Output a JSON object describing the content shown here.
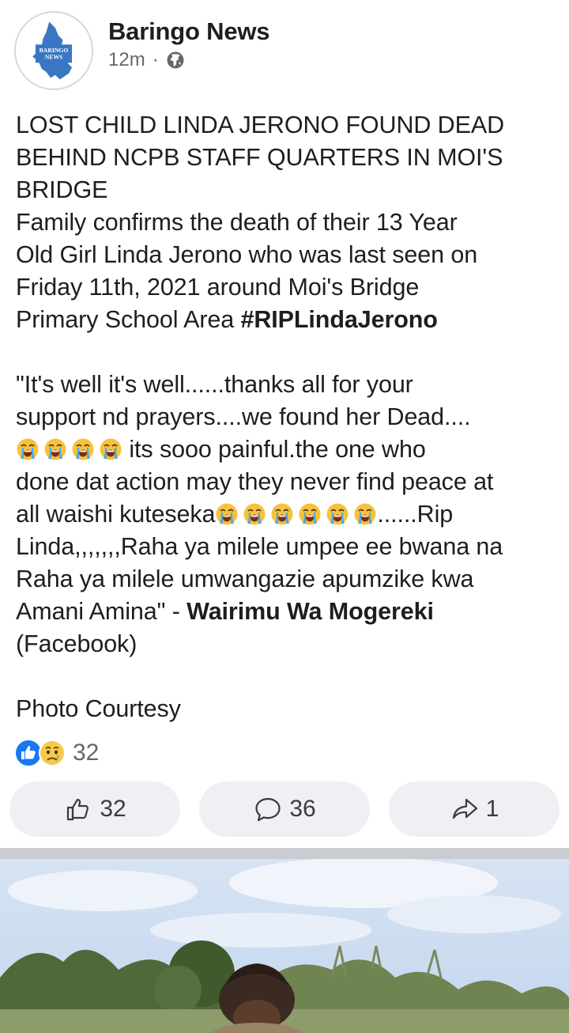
{
  "post": {
    "page_name": "Baringo News",
    "time": "12m",
    "separator": "·",
    "privacy_icon": "globe-icon",
    "avatar_text_1": "BARINGO",
    "avatar_text_2": "NEWS",
    "headline_1": "LOST CHILD LINDA JERONO FOUND DEAD",
    "headline_2": "BEHIND NCPB STAFF QUARTERS IN MOI'S",
    "headline_3": "BRIDGE",
    "para1_1": "Family confirms the death of  their 13 Year",
    "para1_2": "Old Girl Linda Jerono who was last seen on",
    "para1_3": "Friday 11th, 2021 around Moi's Bridge",
    "para1_4": "Primary School Area ",
    "hashtag": "#RIPLindaJerono",
    "quote_1": "\"It's well it's well......thanks all for your",
    "quote_2": "support nd prayers....we found her Dead....",
    "quote_3": " its sooo painful.the one who",
    "quote_4": "done dat action may they never find peace at",
    "quote_5": "all waishi kuteseka",
    "quote_5_end": "......Rip",
    "quote_6": "Linda,,,,,,,Raha ya milele umpee ee bwana na",
    "quote_7": "Raha ya milele umwangazie apumzike kwa",
    "quote_8": "Amani Amina\" - ",
    "author": "Wairimu Wa Mogereki",
    "source": "(Facebook)",
    "photo_credit": "Photo Courtesy",
    "emoji_name": "loudly-crying-face-icon"
  },
  "reactions": {
    "icons": [
      "like-icon",
      "sad-icon"
    ],
    "count": "32"
  },
  "actions": {
    "like_count": "32",
    "comment_count": "36",
    "share_count": "1"
  },
  "colors": {
    "text": "#1c1e21",
    "secondary_text": "#65676b",
    "button_bg": "#eef0f3",
    "like_blue": "#1877f2",
    "avatar_map_blue": "#3b76c4"
  }
}
